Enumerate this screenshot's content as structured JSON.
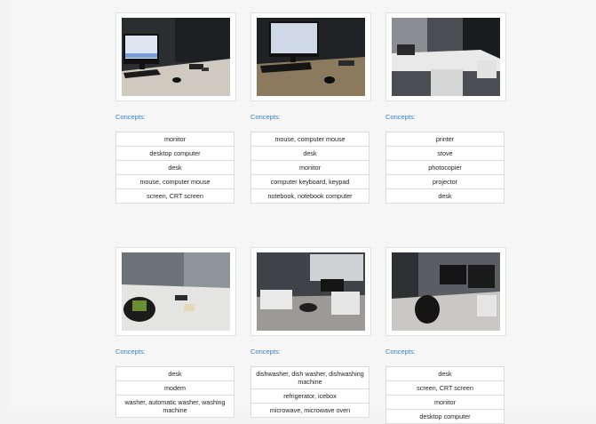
{
  "concepts_label": "Concepts:",
  "cards": [
    {
      "concepts": [
        "monitor",
        "desktop computer",
        "desk",
        "mouse, computer mouse",
        "screen, CRT screen"
      ]
    },
    {
      "concepts": [
        "mouse, computer mouse",
        "desk",
        "monitor",
        "computer keyboard, keypad",
        "notebook, notebook computer"
      ]
    },
    {
      "concepts": [
        "printer",
        "stove",
        "photocopier",
        "projector",
        "desk"
      ]
    },
    {
      "concepts": [
        "desk",
        "modem",
        "washer, automatic washer, washing machine"
      ]
    },
    {
      "concepts": [
        "dishwasher, dish washer, dishwashing machine",
        "refrigerator, icebox",
        "microwave, microwave oven"
      ]
    },
    {
      "concepts": [
        "desk",
        "screen, CRT screen",
        "monitor",
        "desktop computer"
      ]
    }
  ]
}
